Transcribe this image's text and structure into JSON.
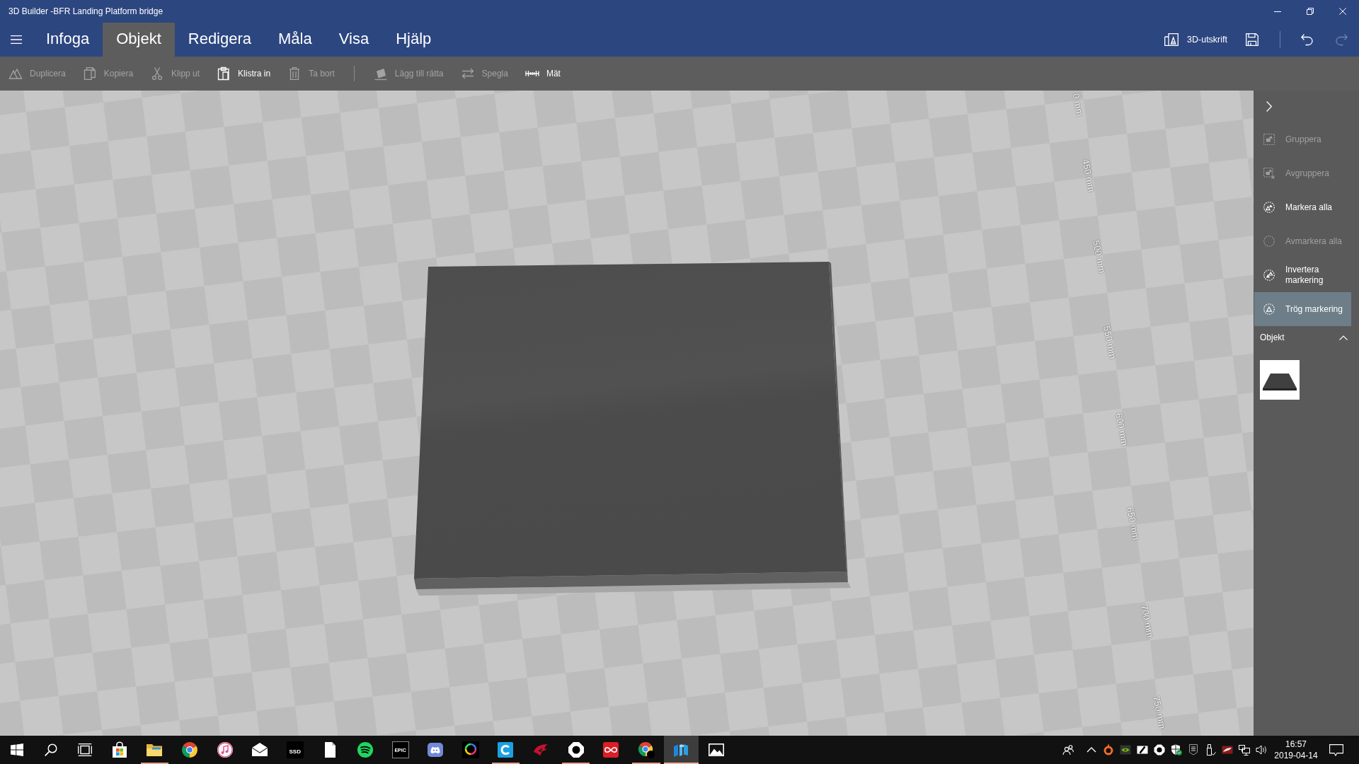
{
  "window": {
    "title": "3D Builder -BFR Landing Platform bridge"
  },
  "menu": {
    "tabs": [
      {
        "label": "Infoga",
        "selected": false
      },
      {
        "label": "Objekt",
        "selected": true
      },
      {
        "label": "Redigera",
        "selected": false
      },
      {
        "label": "Måla",
        "selected": false
      },
      {
        "label": "Visa",
        "selected": false
      },
      {
        "label": "Hjälp",
        "selected": false
      }
    ],
    "actions": [
      {
        "kind": "print",
        "label": "3D-utskrift",
        "disabled": false
      },
      {
        "kind": "save",
        "disabled": false
      },
      {
        "kind": "separator"
      },
      {
        "kind": "undo",
        "disabled": false
      },
      {
        "kind": "redo",
        "disabled": true
      }
    ]
  },
  "toolbar": {
    "items": [
      {
        "kind": "duplicate",
        "label": "Duplicera",
        "disabled": true
      },
      {
        "kind": "copy",
        "label": "Kopiera",
        "disabled": true
      },
      {
        "kind": "cut",
        "label": "Klipp ut",
        "disabled": true
      },
      {
        "kind": "paste",
        "label": "Klistra in",
        "disabled": false
      },
      {
        "kind": "delete",
        "label": "Ta bort",
        "disabled": true
      },
      {
        "kind": "separator"
      },
      {
        "kind": "lay_flat",
        "label": "Lägg till rätta",
        "disabled": true
      },
      {
        "kind": "mirror",
        "label": "Spegla",
        "disabled": true
      },
      {
        "kind": "measure",
        "label": "Mät",
        "disabled": false
      }
    ]
  },
  "viewport": {
    "ruler_labels": [
      "0 mm",
      "450 mm",
      "500 mm",
      "550 mm",
      "600 mm",
      "650 mm",
      "700 mm",
      "750 mm"
    ]
  },
  "side_panel": {
    "items": [
      {
        "kind": "group",
        "label": "Gruppera",
        "disabled": true,
        "selected": false
      },
      {
        "kind": "ungroup",
        "label": "Avgruppera",
        "disabled": true,
        "selected": false
      },
      {
        "kind": "select_all",
        "label": "Markera alla",
        "disabled": false,
        "selected": false
      },
      {
        "kind": "deselect_all",
        "label": "Avmarkera alla",
        "disabled": true,
        "selected": false
      },
      {
        "kind": "invert",
        "label": "Invertera markering",
        "disabled": false,
        "selected": false
      },
      {
        "kind": "lazy",
        "label": "Trög markering",
        "disabled": false,
        "selected": true
      }
    ],
    "objects": {
      "title": "Objekt",
      "expanded": true,
      "items": [
        {
          "selected": false
        }
      ]
    }
  },
  "taskbar": {
    "buttons": [
      {
        "kind": "start"
      },
      {
        "kind": "search"
      },
      {
        "kind": "task_view"
      }
    ],
    "apps": [
      {
        "kind": "store",
        "running": false,
        "active": false
      },
      {
        "kind": "folder",
        "running": true,
        "active": false
      },
      {
        "kind": "browser",
        "running": false,
        "active": false
      },
      {
        "kind": "music",
        "running": false,
        "active": false
      },
      {
        "kind": "mail",
        "running": false,
        "active": false
      },
      {
        "kind": "ssd",
        "label": "SSD",
        "running": false,
        "active": false
      },
      {
        "kind": "document",
        "running": false,
        "active": false
      },
      {
        "kind": "waves",
        "running": false,
        "active": false
      },
      {
        "kind": "epic",
        "label": "EPIC",
        "running": false,
        "active": false
      },
      {
        "kind": "chat",
        "running": false,
        "active": false
      },
      {
        "kind": "rainbow",
        "running": false,
        "active": false
      },
      {
        "kind": "arc",
        "running": true,
        "active": false
      },
      {
        "kind": "emblem",
        "running": false,
        "active": false
      },
      {
        "kind": "octagon",
        "running": true,
        "active": false
      },
      {
        "kind": "loops",
        "running": false,
        "active": false
      },
      {
        "kind": "browser_badge",
        "running": true,
        "active": false
      },
      {
        "kind": "blocks",
        "running": true,
        "active": true
      },
      {
        "kind": "picture",
        "running": false,
        "active": false
      }
    ],
    "tray": [
      {
        "kind": "people"
      },
      {
        "kind": "overflow"
      },
      {
        "kind": "ring"
      },
      {
        "kind": "eye"
      },
      {
        "kind": "slash"
      },
      {
        "kind": "octagon"
      },
      {
        "kind": "shield"
      },
      {
        "kind": "shield_tile"
      },
      {
        "kind": "usb"
      },
      {
        "kind": "emblem"
      },
      {
        "kind": "network"
      },
      {
        "kind": "volume"
      }
    ],
    "clock": {
      "time": "16:57",
      "date": "2019-04-14"
    }
  }
}
